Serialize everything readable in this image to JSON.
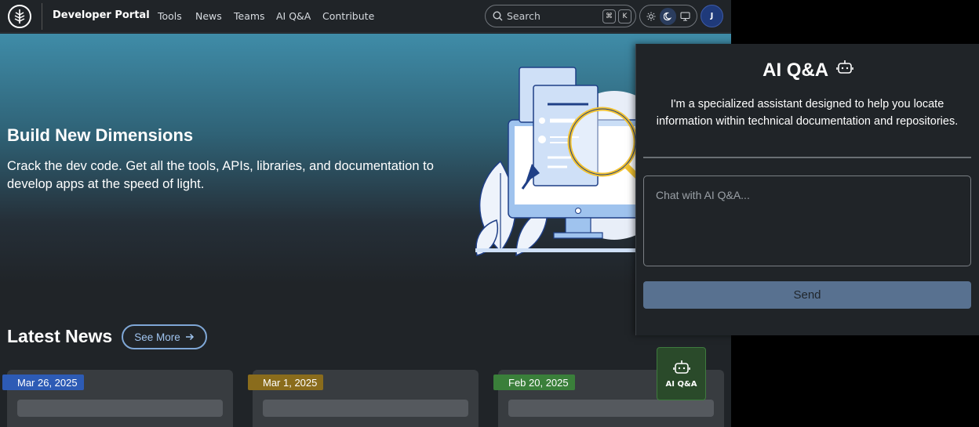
{
  "nav": {
    "brand": "Developer Portal",
    "links": [
      "Tools",
      "News",
      "Teams",
      "AI Q&A",
      "Contribute"
    ],
    "search_label": "Search",
    "kbd_cmd": "⌘",
    "kbd_key": "K",
    "avatar_initial": "J"
  },
  "hero": {
    "title": "Build New Dimensions",
    "subtitle": "Crack the dev code. Get all the tools, APIs, libraries, and documentation to develop apps at the speed of light."
  },
  "news": {
    "title": "Latest News",
    "see_more": "See More",
    "cards": [
      {
        "date": "Mar 26, 2025",
        "color": "#2d5bb5"
      },
      {
        "date": "Mar 1, 2025",
        "color": "#8a6c1c"
      },
      {
        "date": "Feb 20, 2025",
        "color": "#3a7f3a"
      }
    ]
  },
  "fab": {
    "label": "AI Q&A"
  },
  "panel": {
    "title": "AI Q&A",
    "description": "I'm a specialized assistant designed to help you locate information within technical documentation and repositories.",
    "input_placeholder": "Chat with AI Q&A...",
    "send_label": "Send"
  },
  "icons": [
    "tree-logo-icon",
    "search-icon",
    "sun-icon",
    "moon-icon",
    "monitor-icon",
    "robot-icon",
    "arrow-right-icon"
  ]
}
